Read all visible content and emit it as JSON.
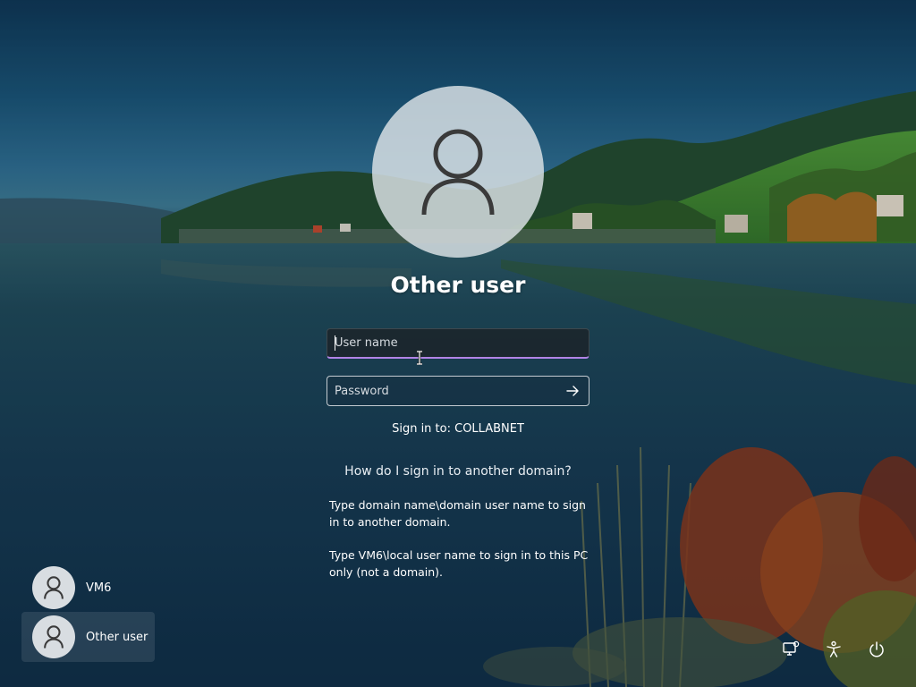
{
  "login": {
    "title": "Other user",
    "username_placeholder": "User name",
    "password_placeholder": "Password",
    "signin_domain": "Sign in to: COLLABNET",
    "help_link": "How do I sign in to another domain?",
    "help_text_1": "Type domain name\\domain user name to sign in to another domain.",
    "help_text_2": "Type VM6\\local user name to sign in to this PC only (not a domain).",
    "accent_color": "#b183e6"
  },
  "users": [
    {
      "name": "VM6",
      "icon": "user-icon"
    },
    {
      "name": "Other user",
      "icon": "user-icon",
      "selected": true
    }
  ],
  "tray": {
    "icons": [
      "network-icon",
      "accessibility-icon",
      "power-icon"
    ]
  }
}
